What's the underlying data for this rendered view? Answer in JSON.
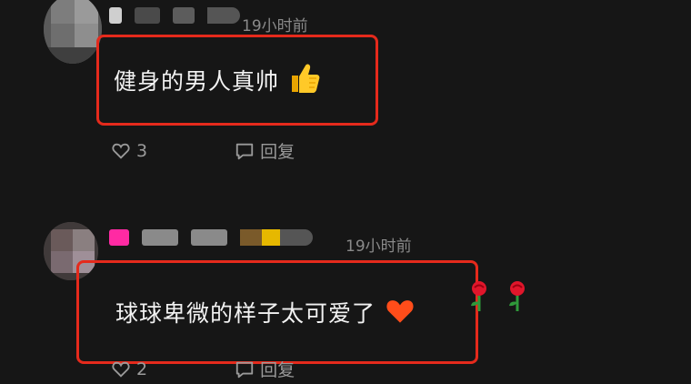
{
  "comments": [
    {
      "time": "19小时前",
      "text": "健身的男人真帅",
      "emoji": "thumbs-up-icon",
      "like_count": "3",
      "reply_label": "回复"
    },
    {
      "time": "19小时前",
      "text": "球球卑微的样子太可爱了",
      "emoji": "heart-icon",
      "trailing_emojis": [
        "rose-icon",
        "rose-icon"
      ],
      "like_count": "2",
      "reply_label": "回复"
    }
  ],
  "colors": {
    "background": "#161616",
    "highlight_border": "#e52a1c",
    "muted_text": "#8a8a8a"
  }
}
